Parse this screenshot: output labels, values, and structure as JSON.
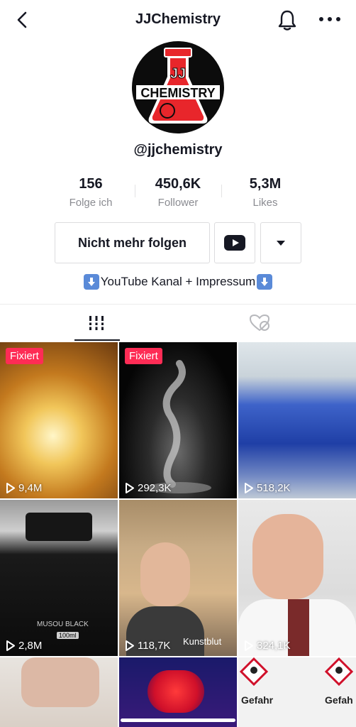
{
  "header": {
    "title": "JJChemistry"
  },
  "profile": {
    "avatar_line1": "JJ",
    "avatar_line2": "CHEMISTRY",
    "handle": "@jjchemistry"
  },
  "stats": [
    {
      "value": "156",
      "label": "Folge ich"
    },
    {
      "value": "450,6K",
      "label": "Follower"
    },
    {
      "value": "5,3M",
      "label": "Likes"
    }
  ],
  "actions": {
    "unfollow_label": "Nicht mehr folgen"
  },
  "bio": {
    "text": "YouTube Kanal + Impressum"
  },
  "videos": [
    {
      "badge": "Fixiert",
      "views": "9,4M"
    },
    {
      "badge": "Fixiert",
      "views": "292,3K"
    },
    {
      "badge": "",
      "views": "518,2K"
    },
    {
      "badge": "",
      "views": "2,8M",
      "caption": "MUSOU BLACK",
      "size": "100ml"
    },
    {
      "badge": "",
      "views": "118,7K",
      "caption": "Kunstblut"
    },
    {
      "badge": "",
      "views": "324,1K"
    },
    {
      "badge": "",
      "views": ""
    },
    {
      "badge": "",
      "views": ""
    },
    {
      "badge": "",
      "views": "",
      "labels": [
        "Gefahr",
        "Gefah"
      ]
    }
  ],
  "colors": {
    "accent": "#fe2c55",
    "text": "#161823",
    "secondary": "#8a8b91"
  }
}
